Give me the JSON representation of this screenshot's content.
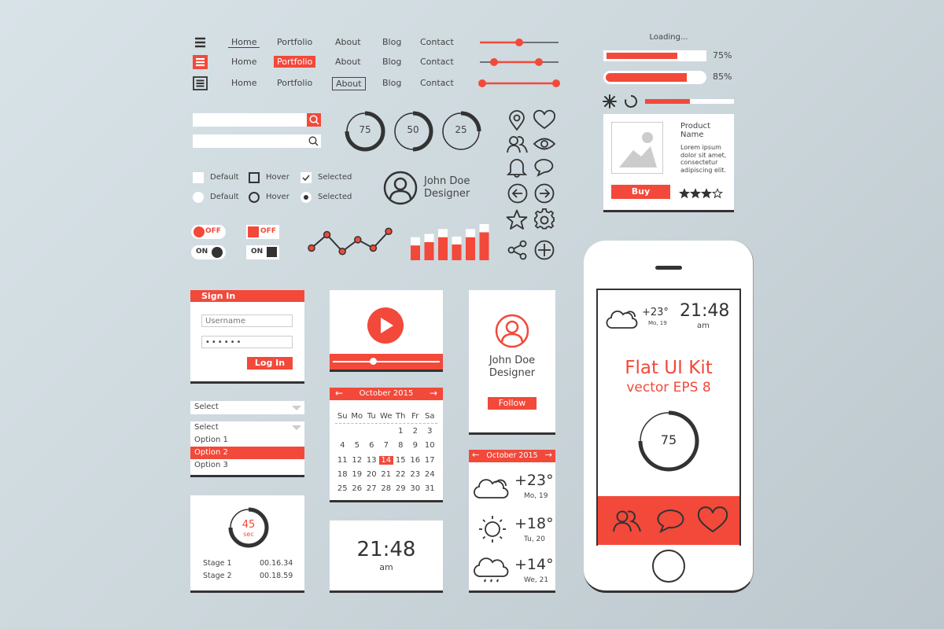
{
  "colors": {
    "accent": "#f2493a",
    "dark": "#333333",
    "background": "#d6e1e6",
    "white": "#ffffff"
  },
  "nav": {
    "rows": [
      {
        "icon": "menu-icon-plain",
        "links": [
          "Home",
          "Portfolio",
          "About",
          "Blog",
          "Contact"
        ],
        "active": "Home",
        "active_style": "underline"
      },
      {
        "icon": "menu-icon-red",
        "links": [
          "Home",
          "Portfolio",
          "About",
          "Blog",
          "Contact"
        ],
        "active": "Portfolio",
        "active_style": "filled"
      },
      {
        "icon": "menu-icon-boxed",
        "links": [
          "Home",
          "Portfolio",
          "About",
          "Blog",
          "Contact"
        ],
        "active": "About",
        "active_style": "boxed"
      }
    ],
    "sliders": [
      {
        "type": "single",
        "value": 0.5
      },
      {
        "type": "range",
        "low": 0.18,
        "high": 0.75
      },
      {
        "type": "range",
        "low": 0.0,
        "high": 1.0
      }
    ]
  },
  "loading": {
    "title": "Loading...",
    "bars": [
      {
        "value": 75,
        "label": "75%"
      },
      {
        "value": 85,
        "label": "85%"
      },
      {
        "value": 50,
        "label": ""
      }
    ],
    "spinner_icons": [
      "asterisk-spinner-icon",
      "circle-spinner-icon"
    ]
  },
  "product": {
    "name_line1": "Product",
    "name_line2": "Name",
    "description": [
      "Lorem ipsum",
      "dolor sit amet,",
      "consectetur",
      "adipiscing elit."
    ],
    "buy_label": "Buy",
    "rating": 3,
    "rating_max": 4
  },
  "search": {
    "fields": [
      {
        "value": "",
        "style": "red-button"
      },
      {
        "value": "",
        "style": "plain-icon"
      }
    ]
  },
  "progress_rings": [
    {
      "value": 75,
      "label": "75"
    },
    {
      "value": 50,
      "label": "50"
    },
    {
      "value": 25,
      "label": "25"
    }
  ],
  "checkboxes": [
    {
      "label": "Default",
      "state": "default"
    },
    {
      "label": "Hover",
      "state": "hover"
    },
    {
      "label": "Selected",
      "state": "selected"
    }
  ],
  "radios": [
    {
      "label": "Default",
      "state": "default"
    },
    {
      "label": "Hover",
      "state": "hover"
    },
    {
      "label": "Selected",
      "state": "selected"
    }
  ],
  "profile_small": {
    "name": "John Doe",
    "role": "Designer"
  },
  "toggles": [
    {
      "label": "OFF",
      "style": "round",
      "on": false
    },
    {
      "label": "ON",
      "style": "round",
      "on": true
    },
    {
      "label": "OFF",
      "style": "square",
      "on": false
    },
    {
      "label": "ON",
      "style": "square",
      "on": true
    }
  ],
  "chart_data": [
    {
      "type": "line",
      "title": "",
      "x": [
        1,
        2,
        3,
        4,
        5,
        6
      ],
      "values": [
        2,
        6,
        1,
        4.5,
        2,
        7
      ],
      "ylim": [
        0,
        8
      ],
      "xlabel": "",
      "ylabel": ""
    },
    {
      "type": "bar",
      "title": "",
      "categories": [
        "1",
        "2",
        "3",
        "4",
        "5",
        "6"
      ],
      "series": [
        {
          "name": "filled",
          "values": [
            45,
            55,
            70,
            48,
            70,
            85
          ]
        },
        {
          "name": "total",
          "values": [
            70,
            80,
            95,
            72,
            95,
            110
          ]
        }
      ],
      "ylim": [
        0,
        110
      ],
      "xlabel": "",
      "ylabel": ""
    }
  ],
  "icons": [
    "map-pin-icon",
    "heart-icon",
    "users-icon",
    "eye-icon",
    "bell-icon",
    "chat-bubble-icon",
    "arrow-left-circle-icon",
    "arrow-right-circle-icon",
    "star-icon",
    "gear-icon",
    "share-icon",
    "plus-circle-icon"
  ],
  "signin": {
    "title": "Sign In",
    "username_placeholder": "Username",
    "password_value": "••••••",
    "login_label": "Log In"
  },
  "select": {
    "closed_label": "Select",
    "open_label": "Select",
    "options": [
      "Option 1",
      "Option 2",
      "Option 3"
    ],
    "selected": "Option 2"
  },
  "timer": {
    "value": "45",
    "unit": "sec",
    "progress": 0.75,
    "stages": [
      {
        "label": "Stage 1",
        "time": "00.16.34"
      },
      {
        "label": "Stage 2",
        "time": "00.18.59"
      }
    ]
  },
  "video": {
    "progress": 0.38
  },
  "calendar": {
    "month": "October 2015",
    "weekdays": [
      "Su",
      "Mo",
      "Tu",
      "We",
      "Th",
      "Fr",
      "Sa"
    ],
    "weeks": [
      [
        "",
        "",
        "",
        "",
        "1",
        "2",
        "3"
      ],
      [
        "4",
        "5",
        "6",
        "7",
        "8",
        "9",
        "10"
      ],
      [
        "11",
        "12",
        "13",
        "14",
        "15",
        "16",
        "17"
      ],
      [
        "18",
        "19",
        "20",
        "21",
        "22",
        "23",
        "24"
      ],
      [
        "25",
        "26",
        "27",
        "28",
        "29",
        "30",
        "31"
      ]
    ],
    "selected_day": "14"
  },
  "clock": {
    "time": "21:48",
    "period": "am"
  },
  "profile_card": {
    "name": "John Doe",
    "role": "Designer",
    "follow_label": "Follow"
  },
  "weather": {
    "month": "October 2015",
    "days": [
      {
        "icon": "cloud-icon",
        "temp": "+23°",
        "date": "Mo, 19"
      },
      {
        "icon": "sun-icon",
        "temp": "+18°",
        "date": "Tu, 20"
      },
      {
        "icon": "rain-cloud-icon",
        "temp": "+14°",
        "date": "We, 21"
      }
    ]
  },
  "phone": {
    "weather_temp": "+23°",
    "weather_date": "Mo, 19",
    "time": "21:48",
    "period": "am",
    "title": "Flat UI Kit",
    "subtitle": "vector EPS 8",
    "ring_value": 75,
    "ring_label": "75",
    "tab_icons": [
      "users-icon",
      "chat-bubble-icon",
      "heart-icon"
    ]
  }
}
